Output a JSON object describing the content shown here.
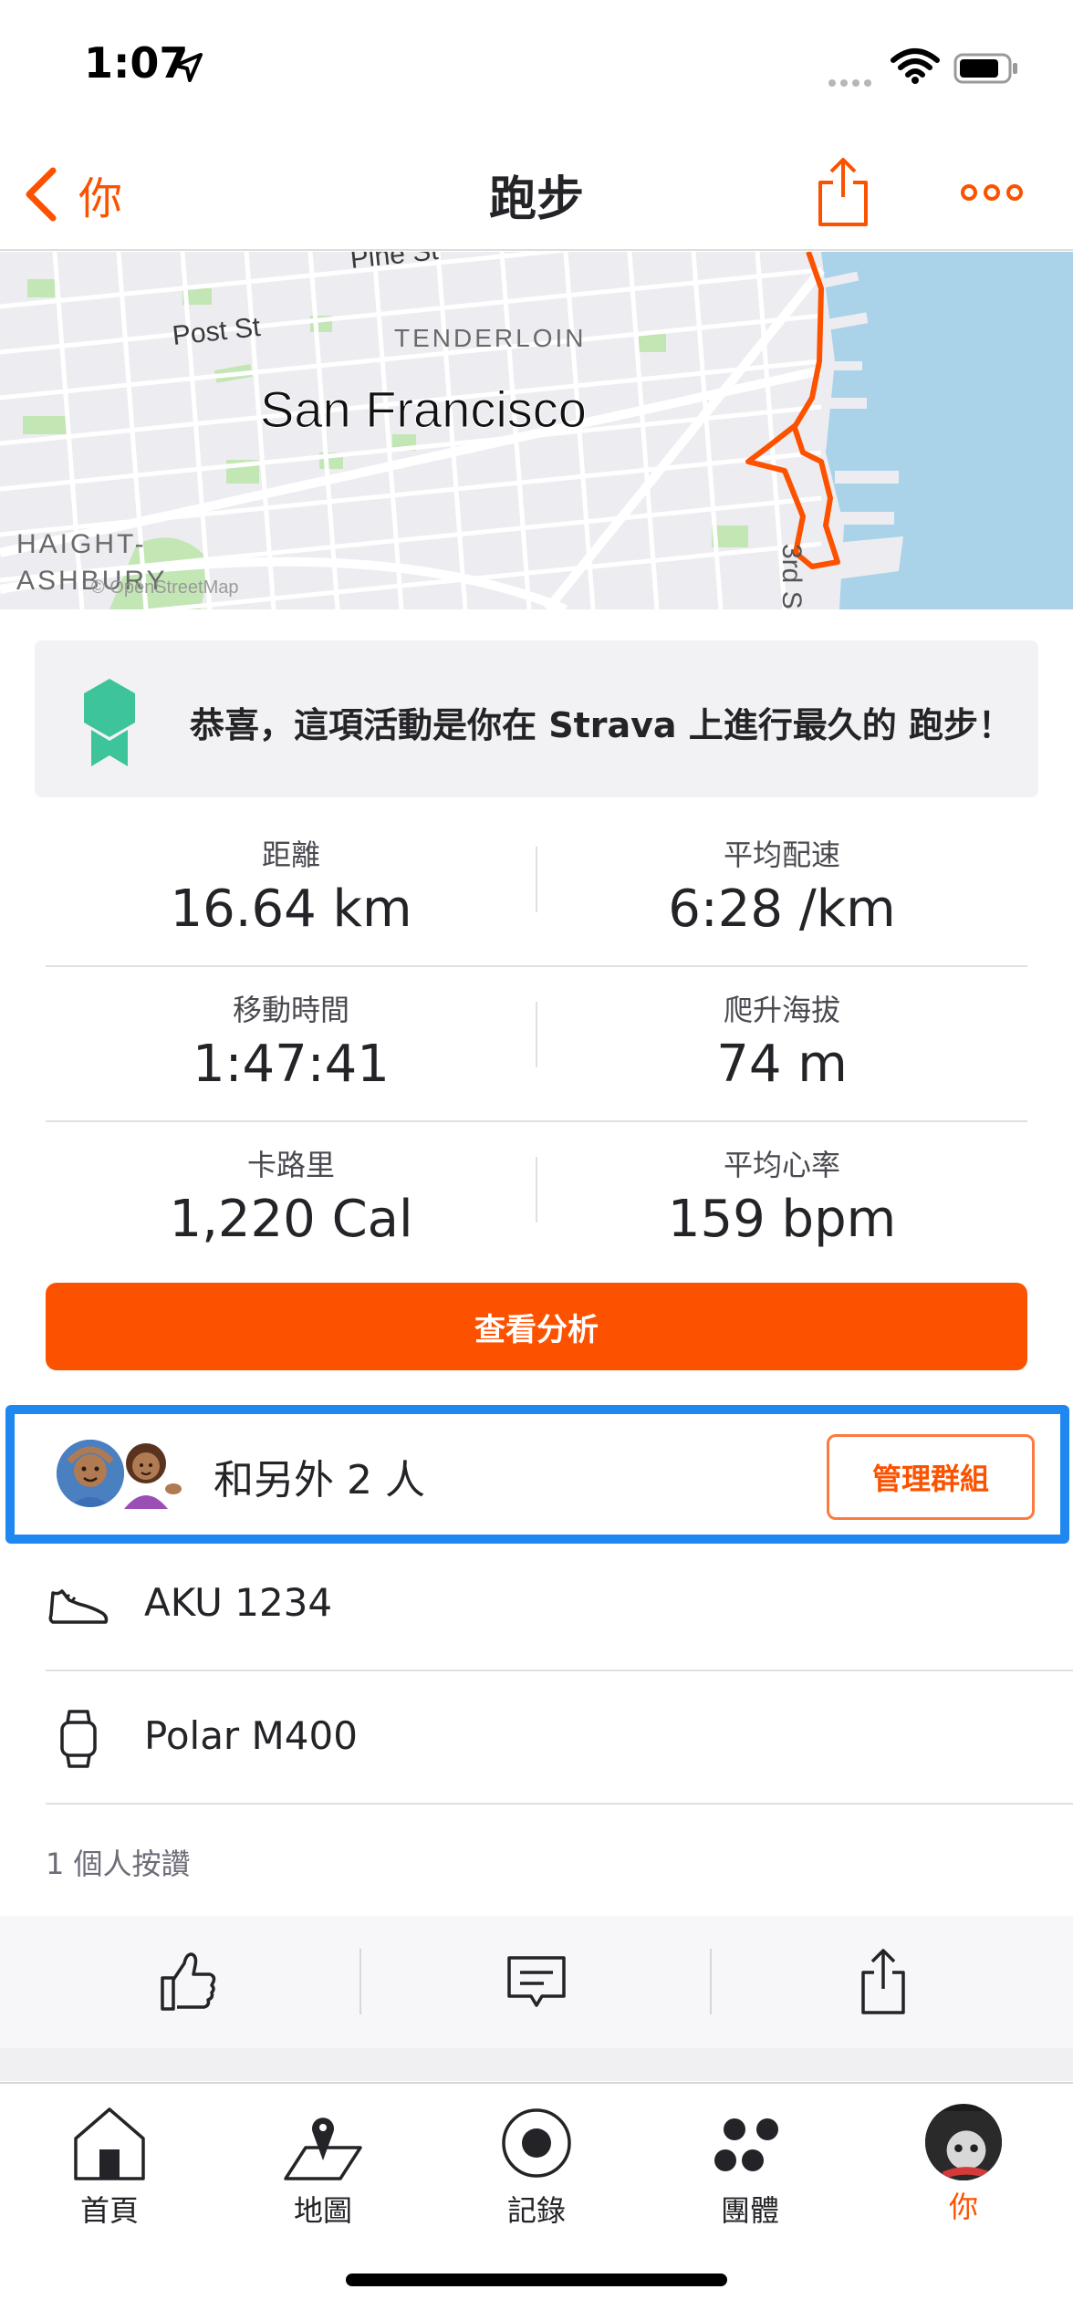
{
  "status_bar": {
    "time": "1:07"
  },
  "nav": {
    "back_label": "你",
    "title": "跑步"
  },
  "map": {
    "labels": {
      "pine": "Pine St",
      "post": "Post St",
      "tenderloin": "TENDERLOIN",
      "city": "San Francisco",
      "haight1": "HAIGHT-",
      "haight2": "ASHBURY",
      "attribution": "© OpenStreetMap",
      "third": "3rd S"
    }
  },
  "achievement": {
    "text": "恭喜，這項活動是你在 Strava 上進行最久的 跑步！"
  },
  "stats": [
    {
      "left": {
        "label": "距離",
        "value": "16.64 km"
      },
      "right": {
        "label": "平均配速",
        "value": "6:28 /km"
      }
    },
    {
      "left": {
        "label": "移動時間",
        "value": "1:47:41"
      },
      "right": {
        "label": "爬升海拔",
        "value": "74 m"
      }
    },
    {
      "left": {
        "label": "卡路里",
        "value": "1,220 Cal"
      },
      "right": {
        "label": "平均心率",
        "value": "159 bpm"
      }
    }
  ],
  "analysis_button": "查看分析",
  "group": {
    "label": "和另外 2 人",
    "manage_button": "管理群組"
  },
  "gear": {
    "shoe": "AKU 1234",
    "device": "Polar M400"
  },
  "kudos_count": "1 個人按讚",
  "tabs": [
    {
      "label": "首頁",
      "icon": "home-icon"
    },
    {
      "label": "地圖",
      "icon": "map-icon"
    },
    {
      "label": "記錄",
      "icon": "record-icon"
    },
    {
      "label": "團體",
      "icon": "groups-icon"
    },
    {
      "label": "你",
      "icon": "avatar"
    }
  ],
  "colors": {
    "accent": "#fc5200",
    "highlight": "#1e88f0",
    "badge": "#3ec49a"
  }
}
